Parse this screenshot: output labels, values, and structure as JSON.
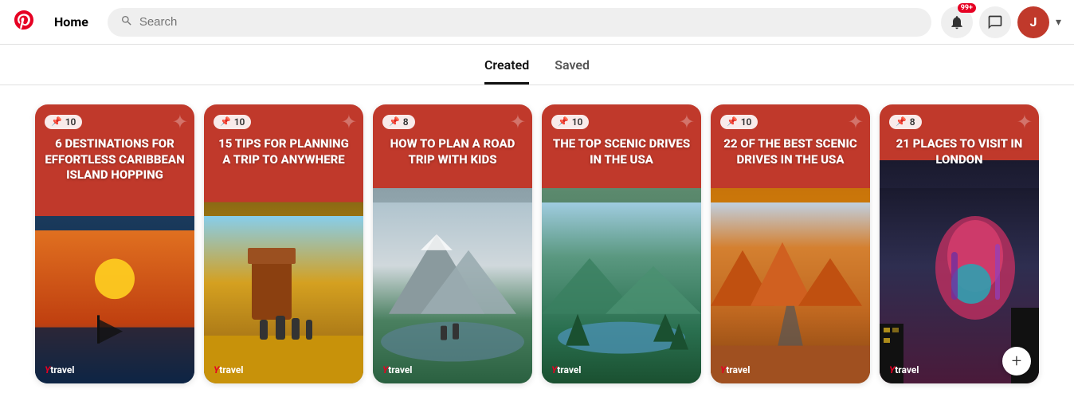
{
  "header": {
    "logo_label": "Pinterest",
    "home_label": "Home",
    "search_placeholder": "Search",
    "notification_badge": "99+",
    "avatar_letter": "J"
  },
  "tabs": [
    {
      "id": "created",
      "label": "Created",
      "active": true
    },
    {
      "id": "saved",
      "label": "Saved",
      "active": false
    }
  ],
  "pins": [
    {
      "id": 1,
      "count": 10,
      "title": "6 DESTINATIONS FOR EFFORTLESS CARIBBEAN ISLAND HOPPING",
      "bg_class": "pin-bg-1",
      "logo": "Ytravel",
      "has_add_btn": false
    },
    {
      "id": 2,
      "count": 10,
      "title": "15 TIPS FOR PLANNING A TRIP TO ANYWHERE",
      "bg_class": "pin-bg-2",
      "logo": "Ytravel",
      "has_add_btn": false
    },
    {
      "id": 3,
      "count": 8,
      "title": "HOW TO PLAN A ROAD TRIP WITH KIDS",
      "bg_class": "pin-bg-3",
      "logo": "Ytravel",
      "has_add_btn": false
    },
    {
      "id": 4,
      "count": 10,
      "title": "THE TOP SCENIC DRIVES IN THE USA",
      "bg_class": "pin-bg-4",
      "logo": "Ytravel",
      "has_add_btn": false
    },
    {
      "id": 5,
      "count": 10,
      "title": "22 OF THE BEST SCENIC DRIVES IN THE USA",
      "bg_class": "pin-bg-5",
      "logo": "Ytravel",
      "has_add_btn": false
    },
    {
      "id": 6,
      "count": 8,
      "title": "21 PLACES TO VISIT IN LONDON",
      "bg_class": "pin-bg-6",
      "logo": "Ytravel",
      "has_add_btn": true
    }
  ]
}
